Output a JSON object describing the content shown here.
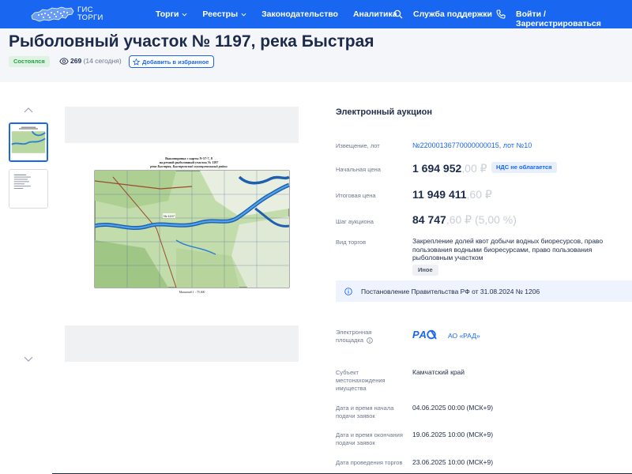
{
  "header": {
    "logo_line1": "ГИС",
    "logo_line2": "ТОРГИ",
    "nav": [
      "Торги",
      "Реестры",
      "Законодательство",
      "Аналитика"
    ],
    "support": "Служба поддержки",
    "login": "Войти / Зарегистрироваться"
  },
  "lot": {
    "title": "Рыболовный участок № 1197, река Быстрая",
    "status": "Состоялся",
    "views": "269",
    "views_today": "(14 сегодня)",
    "favorite_label": "Добавить в избранное"
  },
  "details": {
    "auction_type": "Электронный аукцион",
    "notice_label": "Извещение, лот",
    "notice_value": "№22000136770000000015, лот №10",
    "start_price_label": "Начальная цена",
    "start_price_main": "1 694 952",
    "start_price_cents": ",00 ₽",
    "vat_badge": "НДС не облагается",
    "final_price_label": "Итоговая цена",
    "final_price_main": "11 949 411",
    "final_price_cents": ",60 ₽",
    "step_label": "Шаг аукциона",
    "step_main": "84 747",
    "step_cents": ",60 ₽ (5,00 %)",
    "trade_kind_label": "Вид торгов",
    "trade_kind_value": "Закрепление долей квот добычи водных биоресурсов, право пользования водными биоресурсами, право пользования рыболовным участком",
    "other_badge": "Иное",
    "notice_bar": "Постановление Правительства РФ от 31.08.2024 № 1206",
    "platform_label_1": "Электронная",
    "platform_label_2": "площадка",
    "platform_name": "АО «РАД»",
    "subject_label_1": "Субъект",
    "subject_label_2": "местонахождения",
    "subject_label_3": "имущества",
    "subject_value": "Камчатский край",
    "start_date_label_1": "Дата и время начала",
    "start_date_label_2": "подачи заявок",
    "start_date_value": "04.06.2025 00:00 (МСК+9)",
    "end_date_label_1": "Дата и время окончания",
    "end_date_label_2": "подачи заявок",
    "end_date_value": "19.06.2025 10:00 (МСК+9)",
    "trade_date_label": "Дата проведения торгов",
    "trade_date_value": "23.06.2025 10:00 (МСК+9)"
  },
  "map_image": {
    "caption_1": "Выкопировка с карты N-57-7, 8",
    "caption_2": "на речной рыболовный участок № 1197",
    "caption_3": "река Быстрая, Быстринский муниципальный район",
    "lot_label": "№ 1197",
    "scale": "Масштаб 1 : 75 000"
  },
  "colors": {
    "brand_blue": "#1967f0",
    "status_green": "#2a9d4a",
    "title_navy": "#1d2b4a"
  }
}
